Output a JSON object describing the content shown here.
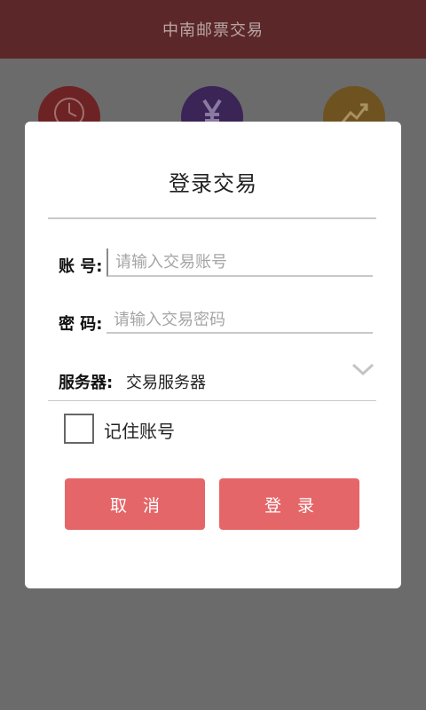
{
  "app": {
    "title": "中南邮票交易"
  },
  "background_icons": [
    "clock-icon",
    "yen-icon",
    "trend-icon"
  ],
  "dialog": {
    "title": "登录交易",
    "account": {
      "label": "账 号:",
      "placeholder": "请输入交易账号",
      "value": ""
    },
    "password": {
      "label": "密 码:",
      "placeholder": "请输入交易密码",
      "value": ""
    },
    "server": {
      "label": "服务器:",
      "selected": "交易服务器"
    },
    "remember": {
      "label": "记住账号",
      "checked": false
    },
    "buttons": {
      "cancel": "取消",
      "login": "登录"
    }
  },
  "colors": {
    "titlebar": "#5c2728",
    "overlay": "#6b6b6b",
    "button": "#e56668",
    "icon_clock": "#6d2324",
    "icon_yen": "#3b2456",
    "icon_trend": "#6e5321"
  }
}
